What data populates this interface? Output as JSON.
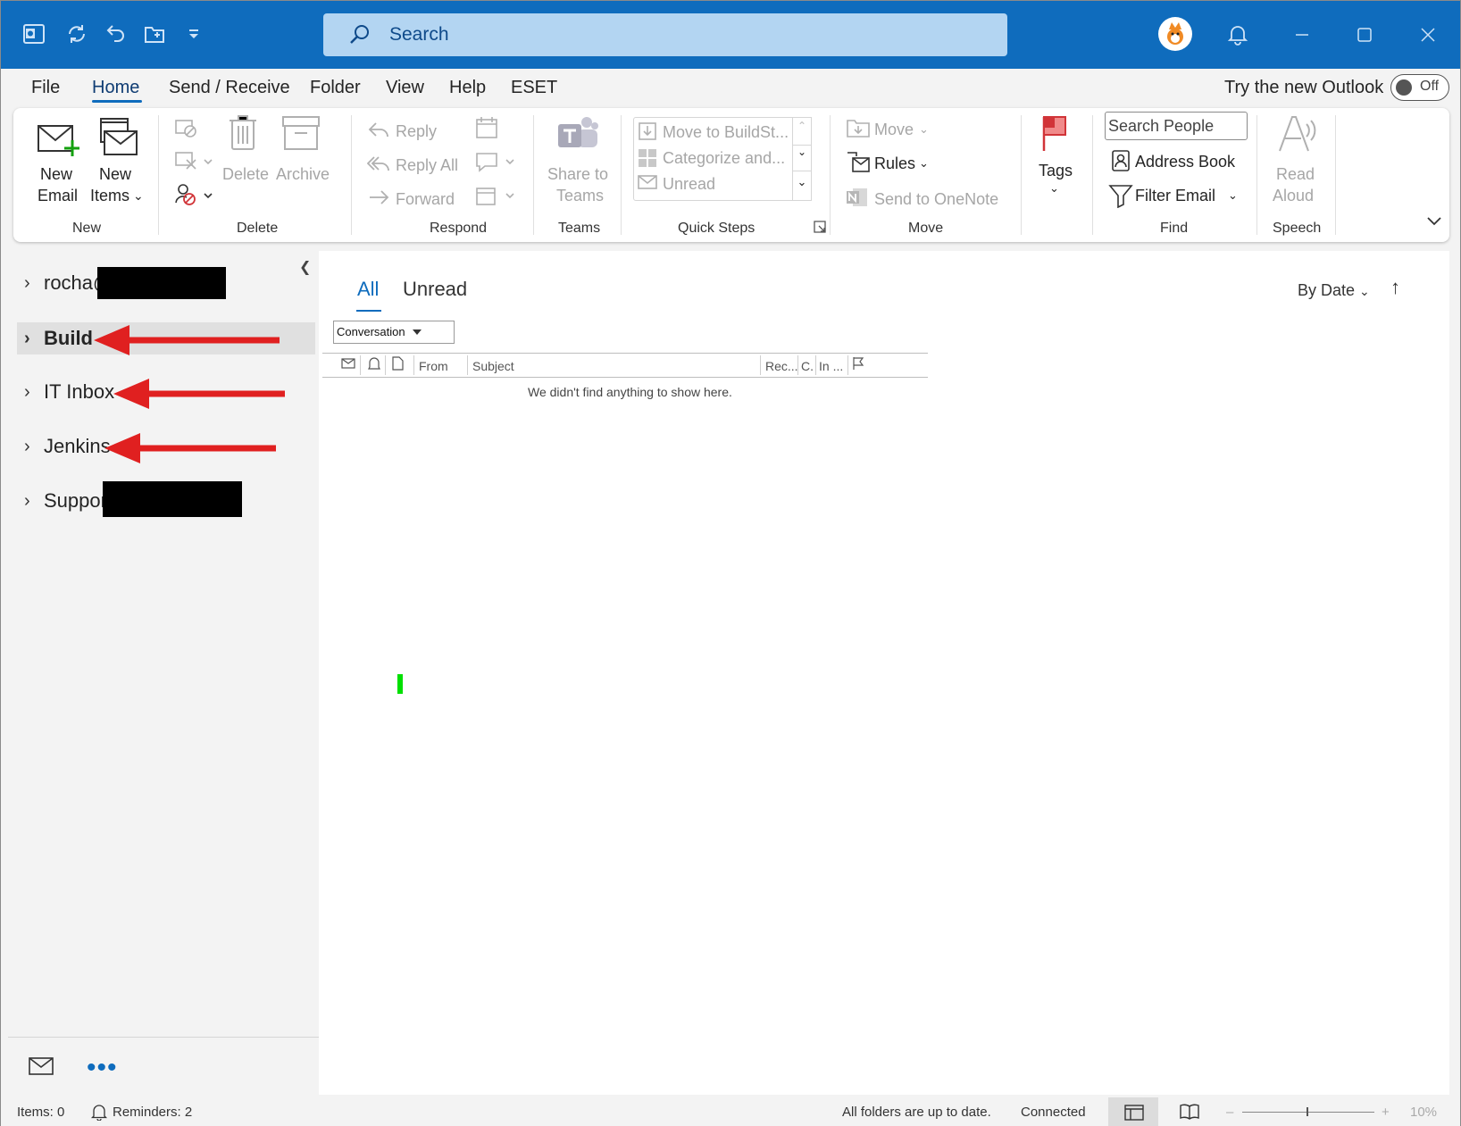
{
  "titlebar": {
    "search_placeholder": "Search",
    "icons": [
      "outlook-icon",
      "sync-icon",
      "undo-icon",
      "folder-icon",
      "customize-icon"
    ],
    "window_controls": [
      "minimize",
      "maximize",
      "close"
    ]
  },
  "menu": {
    "tabs": [
      "File",
      "Home",
      "Send / Receive",
      "Folder",
      "View",
      "Help",
      "ESET"
    ],
    "active_tab": "Home",
    "try_new_label": "Try the new Outlook",
    "toggle_label": "Off"
  },
  "ribbon": {
    "new": {
      "label": "New",
      "new_email": [
        "New",
        "Email"
      ],
      "new_items": [
        "New",
        "Items"
      ]
    },
    "delete": {
      "label": "Delete",
      "delete": "Delete",
      "archive": "Archive"
    },
    "respond": {
      "label": "Respond",
      "reply": "Reply",
      "reply_all": "Reply All",
      "forward": "Forward"
    },
    "teams": {
      "label": "Teams",
      "share": [
        "Share to",
        "Teams"
      ]
    },
    "quick_steps": {
      "label": "Quick Steps",
      "items": [
        "Move to BuildSt...",
        "Categorize and...",
        "Unread"
      ]
    },
    "move": {
      "label": "Move",
      "move": "Move",
      "rules": "Rules",
      "onenote": "Send to OneNote"
    },
    "tags": {
      "label": "Tags"
    },
    "find": {
      "label": "Find",
      "search_people": "Search People",
      "address_book": "Address Book",
      "filter_email": "Filter Email"
    },
    "speech": {
      "label": "Speech",
      "read_aloud": [
        "Read",
        "Aloud"
      ]
    }
  },
  "folders": {
    "items": [
      {
        "label": "rocha@",
        "selected": false
      },
      {
        "label": "Build",
        "selected": true
      },
      {
        "label": "IT Inbox",
        "selected": false
      },
      {
        "label": "Jenkins",
        "selected": false
      },
      {
        "label": "Support",
        "selected": false
      }
    ]
  },
  "message_list": {
    "filter_tabs": [
      "All",
      "Unread"
    ],
    "active_filter": "All",
    "sort_label": "By Date",
    "arrangement": "Conversation",
    "columns": [
      "From",
      "Subject",
      "Rec...",
      "C.",
      "In ..."
    ],
    "empty_text": "We didn't find anything to show here."
  },
  "status": {
    "items": "Items: 0",
    "reminders": "Reminders: 2",
    "sync": "All folders are up to date.",
    "connection": "Connected",
    "zoom": "10%"
  },
  "colors": {
    "titlebar": "#0f6cbd",
    "search_box": "#b3d5f2",
    "accent": "#0f6cbd",
    "annotation_arrow": "#e02020"
  }
}
